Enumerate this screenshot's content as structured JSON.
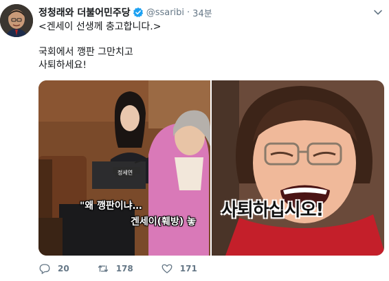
{
  "author": {
    "display_name": "정청래와 더불어민주당",
    "handle": "@ssaribi",
    "separator": "·",
    "time": "34분"
  },
  "tweet": {
    "lines": [
      "<겐세이 선생께 충고합니다.>",
      "",
      "국회에서 깽판 그만치고",
      "사퇴하세요!"
    ]
  },
  "media": {
    "left": {
      "nameplate": "정세연",
      "subtitle_1": "\"왜 깽판이냐…",
      "subtitle_2": "겐세이(훼방) 놓"
    },
    "right": {
      "stamp_text": "사퇴하십시오!"
    }
  },
  "actions": {
    "reply_count": "20",
    "retweet_count": "178",
    "like_count": "171"
  },
  "icons": {
    "verified": "verified-badge-icon",
    "caret": "chevron-down-icon",
    "reply": "reply-icon",
    "retweet": "retweet-icon",
    "like": "heart-icon"
  },
  "colors": {
    "verified": "#1da1f2",
    "secondary_text": "#657786",
    "primary_text": "#14171a"
  }
}
